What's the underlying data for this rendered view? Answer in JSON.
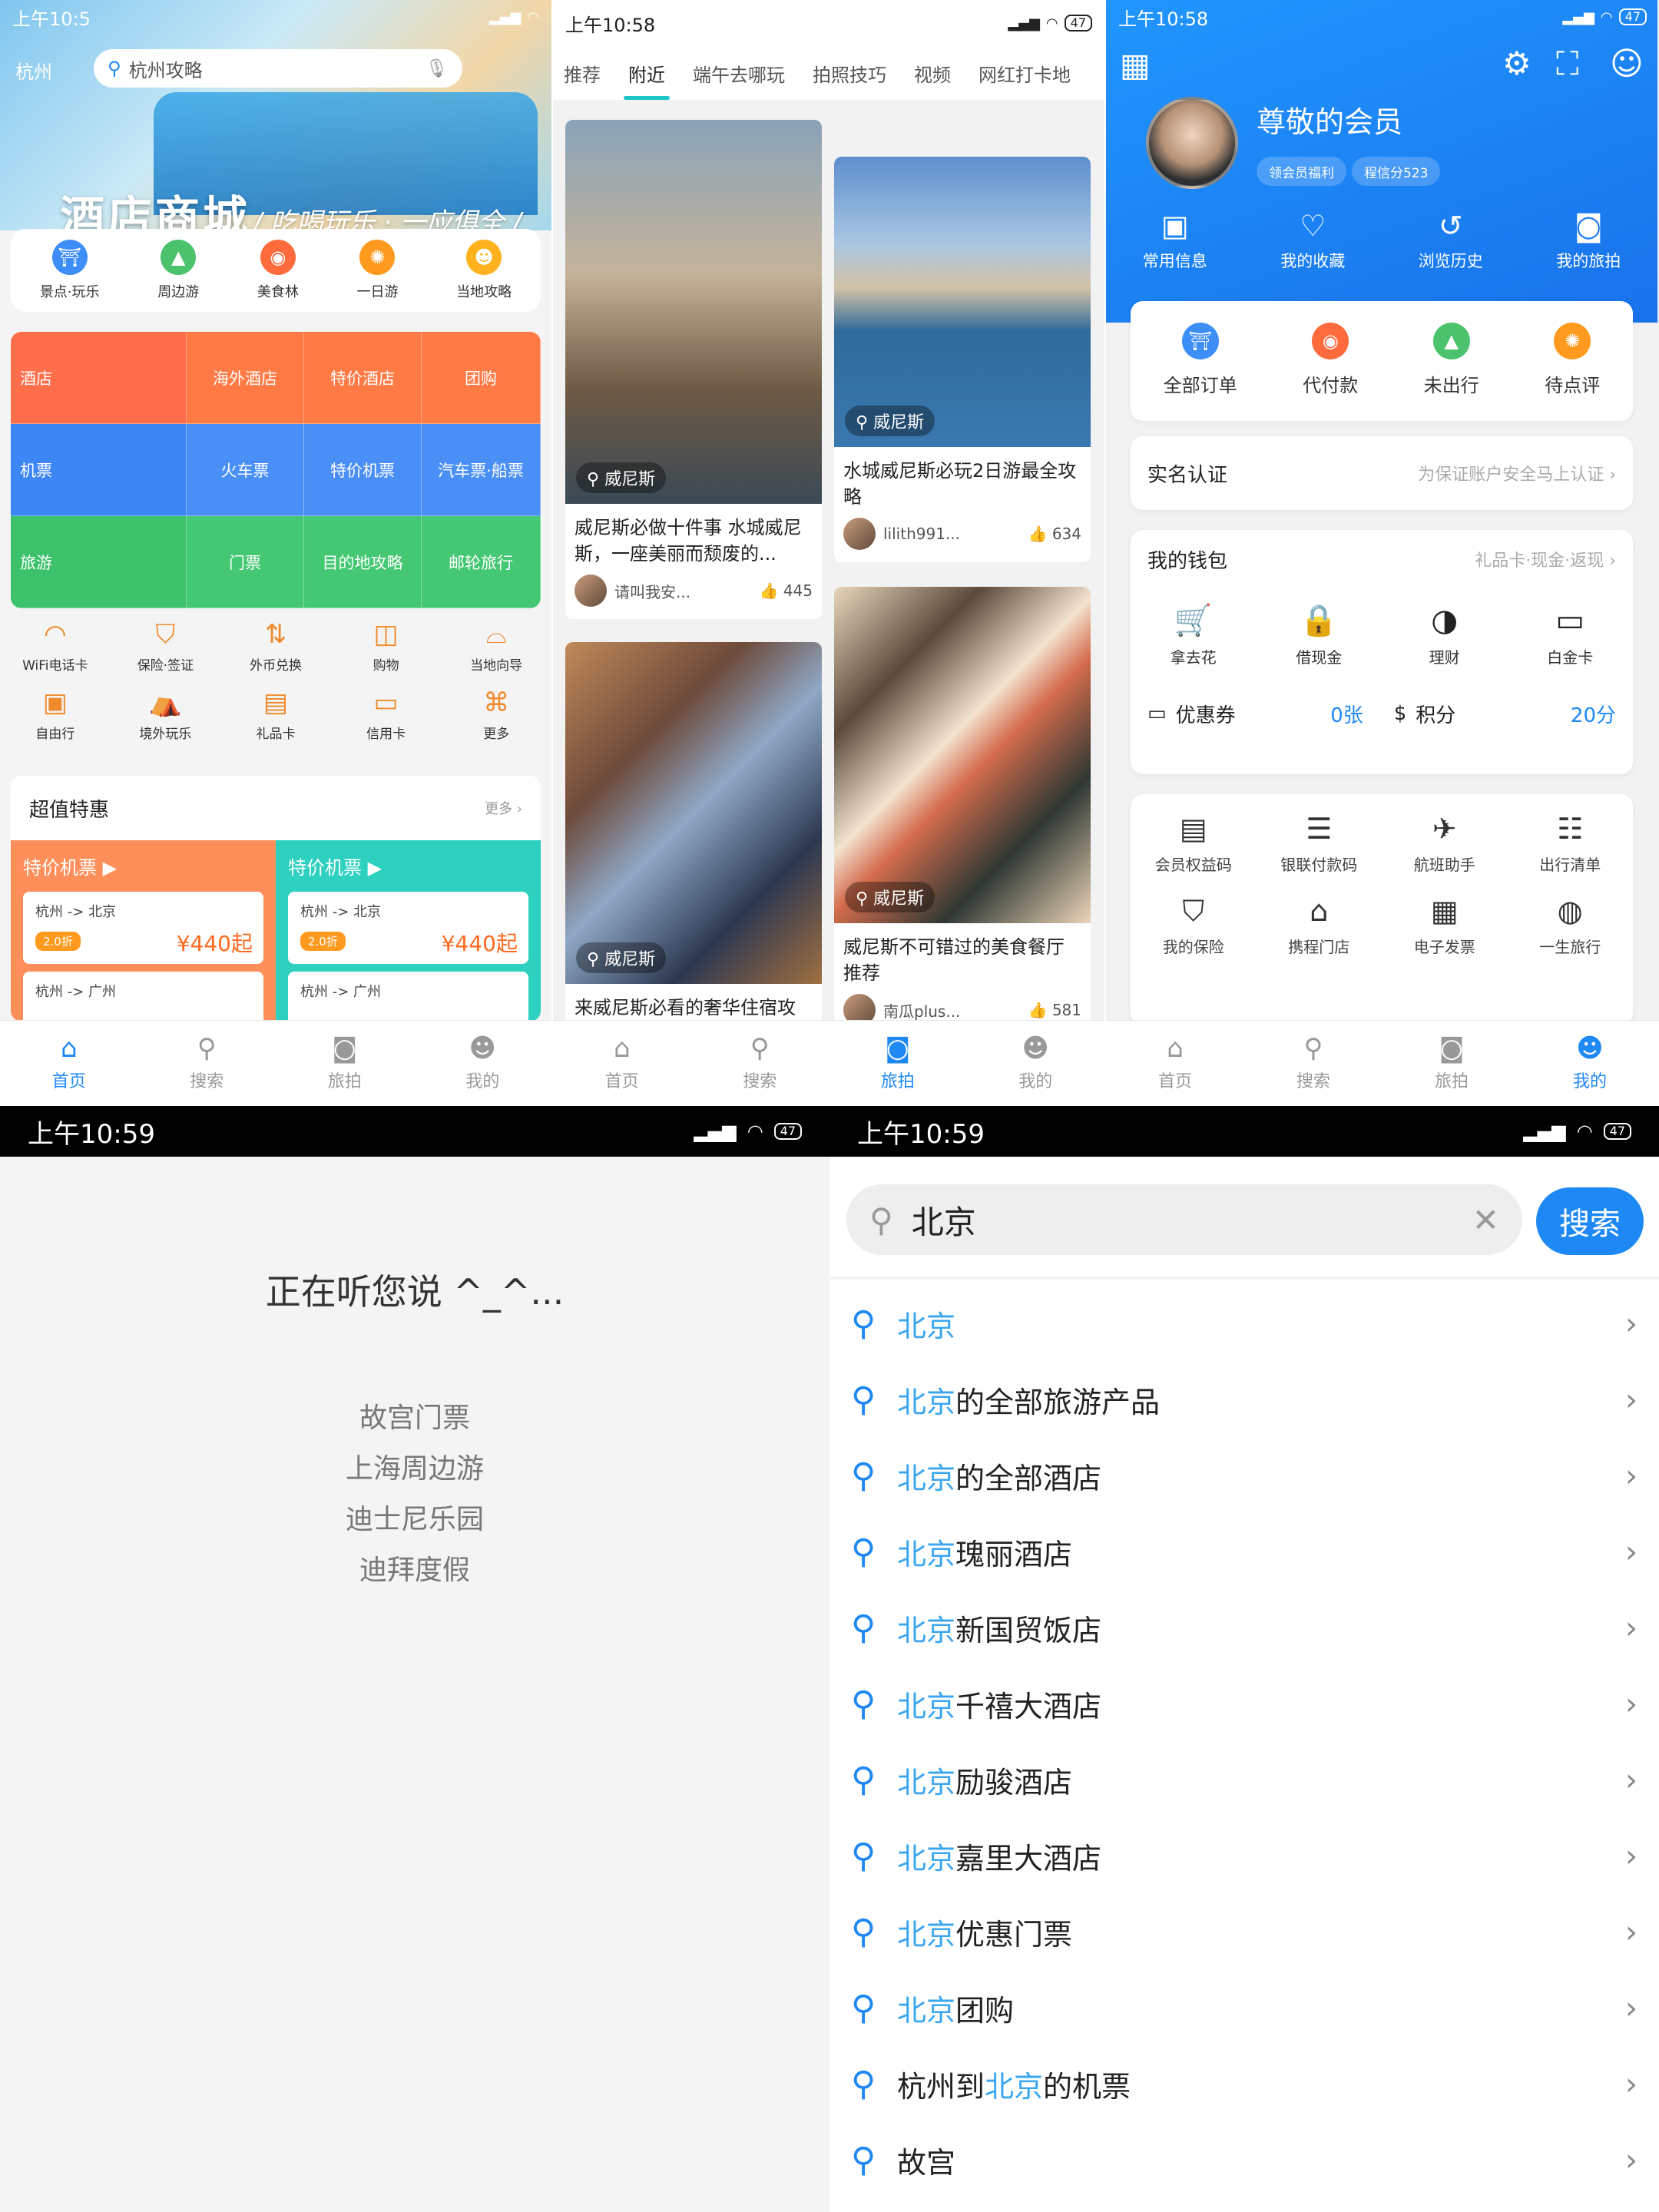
{
  "colors": {
    "accent": "#1e88f5",
    "teal": "#1fc4c4",
    "orange": "#ff7a3d"
  },
  "p1": {
    "status_time": "上午10:5",
    "city": "杭州",
    "search_placeholder": "杭州攻略",
    "hero_title": "酒店商城",
    "hero_sub": "/ 吃喝玩乐 · 一应俱全 /",
    "quick": [
      "景点·玩乐",
      "周边游",
      "美食林",
      "一日游",
      "当地攻略"
    ],
    "grid": {
      "rows": [
        {
          "lead": "酒店",
          "cells": [
            "海外酒店",
            "特价酒店",
            "团购"
          ]
        },
        {
          "lead": "机票",
          "cells": [
            "火车票",
            "特价机票",
            "汽车票·船票"
          ]
        },
        {
          "lead": "旅游",
          "cells": [
            "门票",
            "目的地攻略",
            "邮轮旅行"
          ]
        }
      ]
    },
    "icons": [
      "WiFi电话卡",
      "保险·签证",
      "外币兑换",
      "购物",
      "当地向导",
      "自由行",
      "境外玩乐",
      "礼品卡",
      "信用卡",
      "更多"
    ],
    "deal_title": "超值特惠",
    "deal_more": "更多",
    "deal_cols": [
      {
        "title": "特价机票",
        "tickets": [
          {
            "route": "杭州 -> 北京",
            "badge": "2.0折",
            "price": "¥440起"
          },
          {
            "route": "杭州 -> 广州",
            "badge": "",
            "price": ""
          }
        ]
      },
      {
        "title": "特价机票",
        "tickets": [
          {
            "route": "杭州 -> 北京",
            "badge": "2.0折",
            "price": "¥440起"
          },
          {
            "route": "杭州 -> 广州",
            "badge": "",
            "price": ""
          }
        ]
      }
    ],
    "nav": [
      "首页",
      "搜索",
      "旅拍",
      "我的"
    ]
  },
  "p2": {
    "status_time": "上午10:58",
    "tabs": [
      "推荐",
      "附近",
      "端午去哪玩",
      "拍照技巧",
      "视频",
      "网红打卡地"
    ],
    "feed": [
      {
        "loc": "威尼斯",
        "title": "威尼斯必做十件事 水城威尼斯，一座美丽而颓废的...",
        "user": "请叫我安...",
        "likes": "445"
      },
      {
        "loc": "威尼斯",
        "title": "水城威尼斯必玩2日游最全攻略",
        "user": "lilith991...",
        "likes": "634"
      },
      {
        "loc": "威尼斯",
        "title": "来威尼斯必看的奢华住宿攻",
        "user": "",
        "likes": ""
      },
      {
        "loc": "威尼斯",
        "title": "威尼斯不可错过的美食餐厅推荐",
        "user": "南瓜plus...",
        "likes": "581"
      }
    ],
    "nav": [
      "首页",
      "搜索",
      "旅拍",
      "我的"
    ]
  },
  "p3": {
    "status_time": "上午10:58",
    "name": "尊敬的会员",
    "pill1": "领会员福利",
    "pill2": "程信分523",
    "top": [
      "常用信息",
      "我的收藏",
      "浏览历史",
      "我的旅拍"
    ],
    "orders": [
      "全部订单",
      "代付款",
      "未出行",
      "待点评"
    ],
    "verify": "实名认证",
    "verify_sub": "为保证账户安全马上认证",
    "wallet": "我的钱包",
    "wallet_sub": "礼品卡·现金·返现",
    "wallet_items": [
      "拿去花",
      "借现金",
      "理财",
      "白金卡"
    ],
    "coupon": "优惠券",
    "coupon_val": "0张",
    "points": "积分",
    "points_val": "20分",
    "tools": [
      "会员权益码",
      "银联付款码",
      "航班助手",
      "出行清单",
      "我的保险",
      "携程门店",
      "电子发票",
      "一生旅行"
    ],
    "nav": [
      "首页",
      "搜索",
      "旅拍",
      "我的"
    ]
  },
  "p4": {
    "status_time": "上午10:59",
    "listening": "正在听您说 ^_^...",
    "suggestions": [
      "故宫门票",
      "上海周边游",
      "迪士尼乐园",
      "迪拜度假"
    ]
  },
  "p5": {
    "status_time": "上午10:59",
    "query": "北京",
    "search_btn": "搜索",
    "results": [
      {
        "pre": "",
        "hl": "北京",
        "post": ""
      },
      {
        "pre": "",
        "hl": "北京",
        "post": "的全部旅游产品"
      },
      {
        "pre": "",
        "hl": "北京",
        "post": "的全部酒店"
      },
      {
        "pre": "",
        "hl": "北京",
        "post": "瑰丽酒店"
      },
      {
        "pre": "",
        "hl": "北京",
        "post": "新国贸饭店"
      },
      {
        "pre": "",
        "hl": "北京",
        "post": "千禧大酒店"
      },
      {
        "pre": "",
        "hl": "北京",
        "post": "励骏酒店"
      },
      {
        "pre": "",
        "hl": "北京",
        "post": "嘉里大酒店"
      },
      {
        "pre": "",
        "hl": "北京",
        "post": "优惠门票"
      },
      {
        "pre": "",
        "hl": "北京",
        "post": "团购"
      },
      {
        "pre": "杭州到",
        "hl": "北京",
        "post": "的机票"
      },
      {
        "pre": "",
        "hl": "",
        "post": "故宫"
      }
    ]
  }
}
